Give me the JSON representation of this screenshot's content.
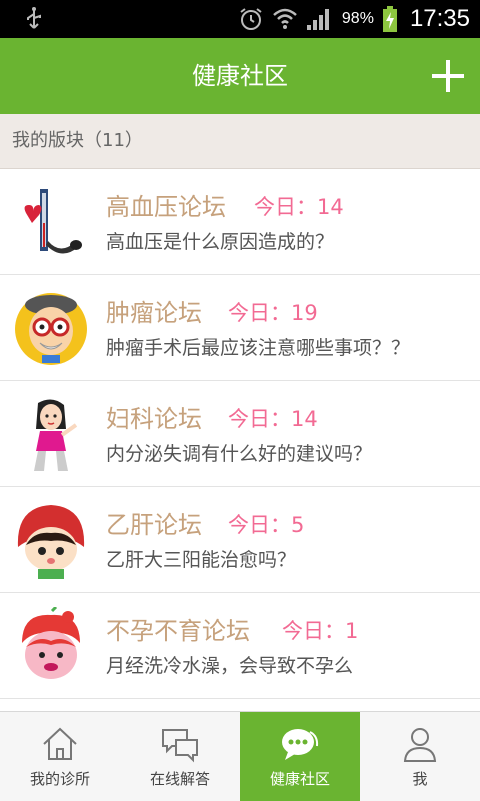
{
  "status_bar": {
    "battery": "98%",
    "time": "17:35"
  },
  "header": {
    "title": "健康社区"
  },
  "section": {
    "label": "我的版块（11）"
  },
  "forums": [
    {
      "name": "高血压论坛",
      "today": "今日：14",
      "question": "高血压是什么原因造成的？",
      "icon": "blood-pressure-monitor-icon"
    },
    {
      "name": "肿瘤论坛",
      "today": "今日：19",
      "question": "肿瘤手术后最应该注意哪些事项？？",
      "icon": "old-doctor-cartoon-icon"
    },
    {
      "name": "妇科论坛",
      "today": "今日：14",
      "question": "内分泌失调有什么好的建议吗？",
      "icon": "woman-cartoon-icon"
    },
    {
      "name": "乙肝论坛",
      "today": "今日：5",
      "question": "乙肝大三阳能治愈吗？",
      "icon": "red-hood-girl-cartoon-icon"
    },
    {
      "name": "不孕不育论坛",
      "today": "今日：1",
      "question": "月经洗冷水澡，会导致不孕么",
      "icon": "red-apple-girl-cartoon-icon"
    }
  ],
  "bottom_nav": [
    {
      "label": "我的诊所",
      "icon": "house-icon",
      "active": false
    },
    {
      "label": "在线解答",
      "icon": "chat-bubbles-icon",
      "active": false
    },
    {
      "label": "健康社区",
      "icon": "community-chat-icon",
      "active": true
    },
    {
      "label": "我",
      "icon": "person-icon",
      "active": false
    }
  ],
  "colors": {
    "brand_green": "#6ab431",
    "forum_name": "#c6a17c",
    "today_count": "#f26a93"
  }
}
